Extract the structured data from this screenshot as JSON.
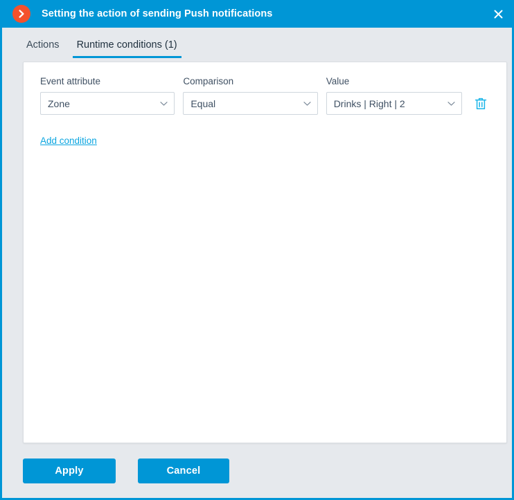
{
  "window": {
    "title": "Setting the action of sending Push notifications",
    "app_icon": "chevron-right-circle-icon",
    "close_icon": "close-icon",
    "accent_color": "#0096d6",
    "badge_color": "#f4512c"
  },
  "tabs": [
    {
      "label": "Actions",
      "active": false
    },
    {
      "label": "Runtime conditions (1)",
      "active": true
    }
  ],
  "conditions_panel": {
    "labels": {
      "event_attribute": "Event attribute",
      "comparison": "Comparison",
      "value": "Value"
    },
    "rows": [
      {
        "event_attribute": "Zone",
        "comparison": "Equal",
        "value": "Drinks | Right | 2",
        "delete_icon": "trash-icon",
        "caret_icon": "chevron-down-icon"
      }
    ],
    "add_condition_label": "Add condition",
    "link_color": "#0aa5e0",
    "delete_icon_color": "#1ab5e8"
  },
  "footer": {
    "apply_label": "Apply",
    "cancel_label": "Cancel"
  }
}
